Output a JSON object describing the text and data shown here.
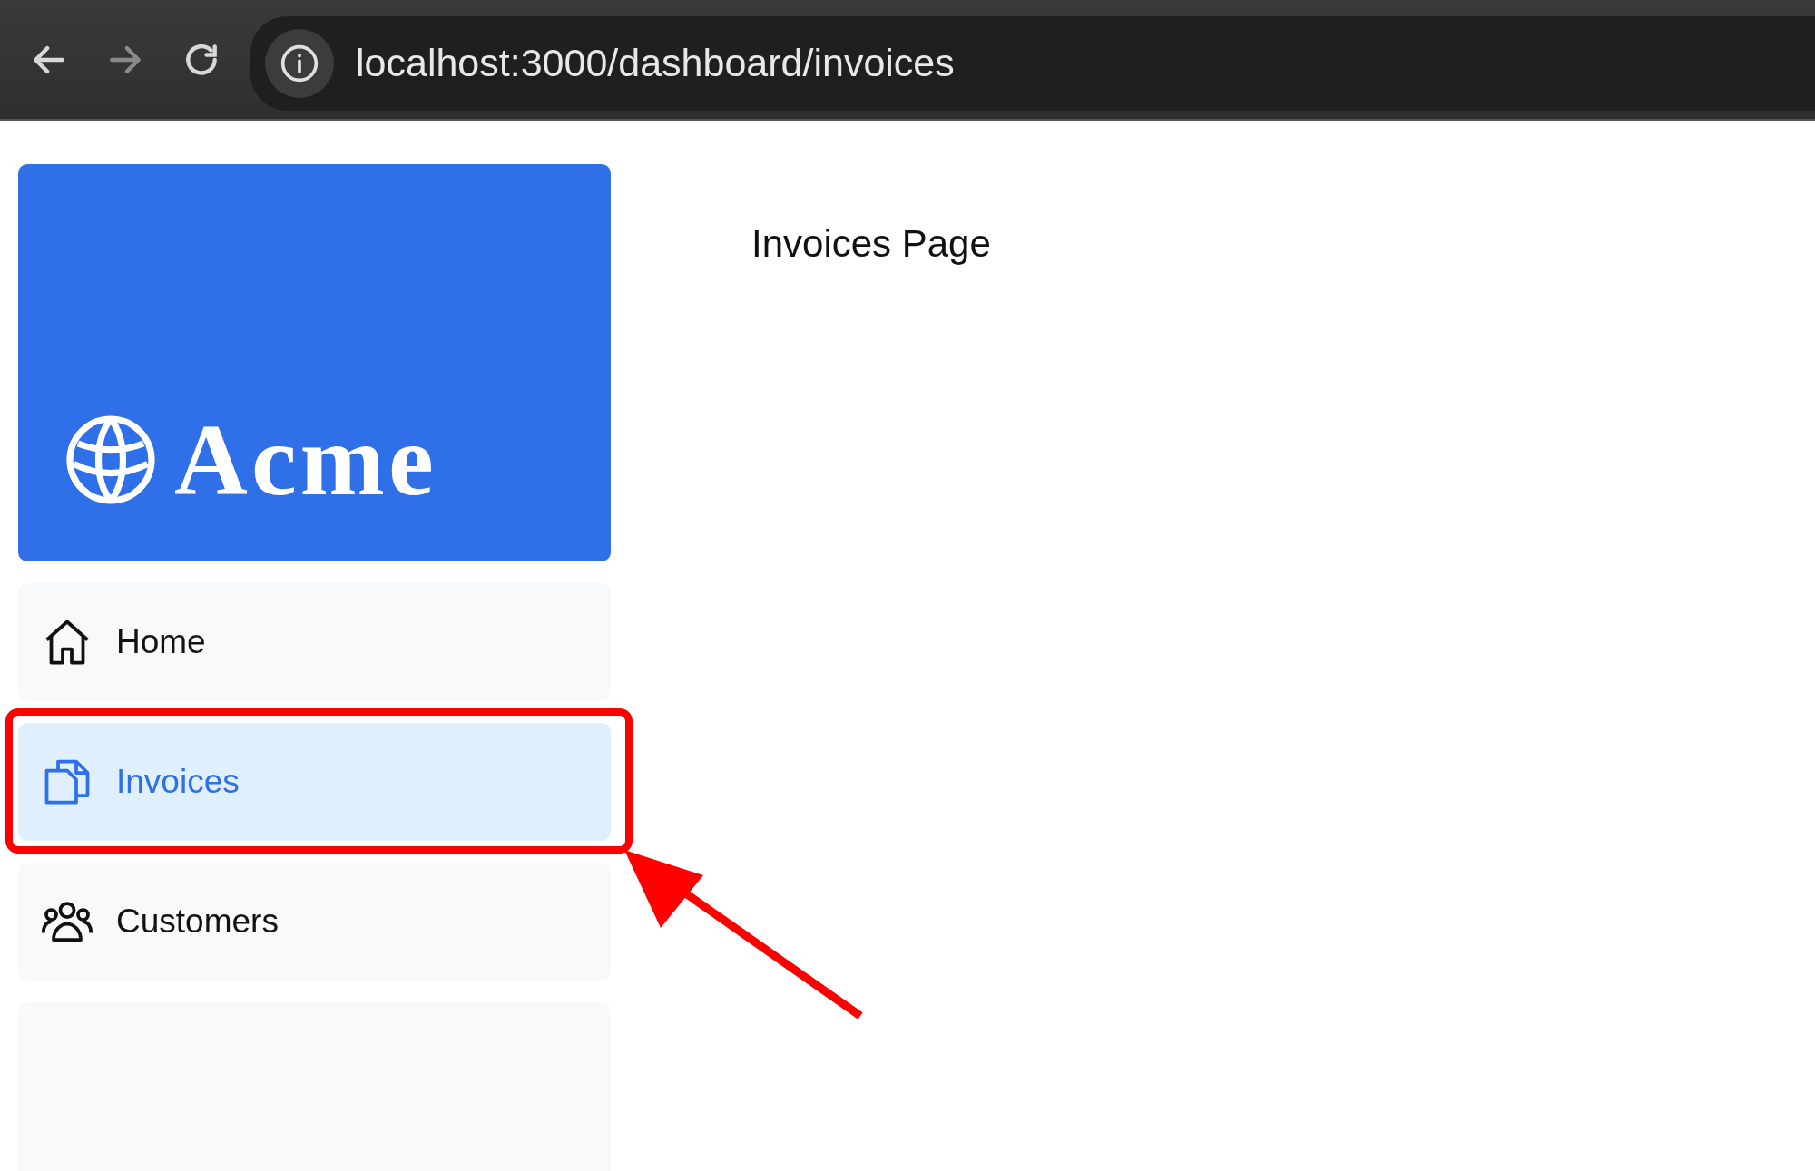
{
  "browser": {
    "url": "localhost:3000/dashboard/invoices",
    "back_disabled": false,
    "forward_disabled": true
  },
  "logo": {
    "text": "Acme"
  },
  "sidebar": {
    "items": [
      {
        "label": "Home",
        "selected": false
      },
      {
        "label": "Invoices",
        "selected": true
      },
      {
        "label": "Customers",
        "selected": false
      }
    ]
  },
  "main": {
    "heading": "Invoices Page"
  }
}
